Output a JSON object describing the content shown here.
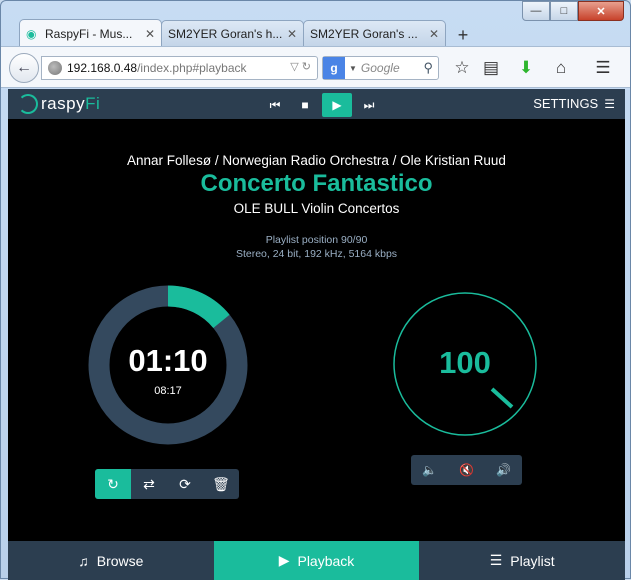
{
  "browser": {
    "tabs": [
      {
        "title": "RaspyFi - Mus..."
      },
      {
        "title": "SM2YER Goran's h..."
      },
      {
        "title": "SM2YER Goran's ..."
      }
    ],
    "url_host": "192.168.0.48",
    "url_path": "/index.php#playback",
    "search_placeholder": "Google",
    "new_tab_symbol": "+"
  },
  "app": {
    "logo_left": "raspy",
    "logo_right": "Fi",
    "settings_label": "SETTINGS",
    "accent_color": "#1abc9c",
    "bar_color": "#2c3e50"
  },
  "playback": {
    "artist": "Annar Follesø / Norwegian Radio Orchestra / Ole Kristian Ruud",
    "title": "Concerto Fantastico",
    "album": "OLE BULL Violin Concertos",
    "playlist_position": "Playlist position 90/90",
    "format": "Stereo, 24 bit, 192 kHz, 5164 kbps",
    "elapsed": "01:10",
    "total": "08:17",
    "progress_fraction": 0.141,
    "volume": "100"
  },
  "nav": {
    "browse": "Browse",
    "playback": "Playback",
    "playlist": "Playlist"
  }
}
